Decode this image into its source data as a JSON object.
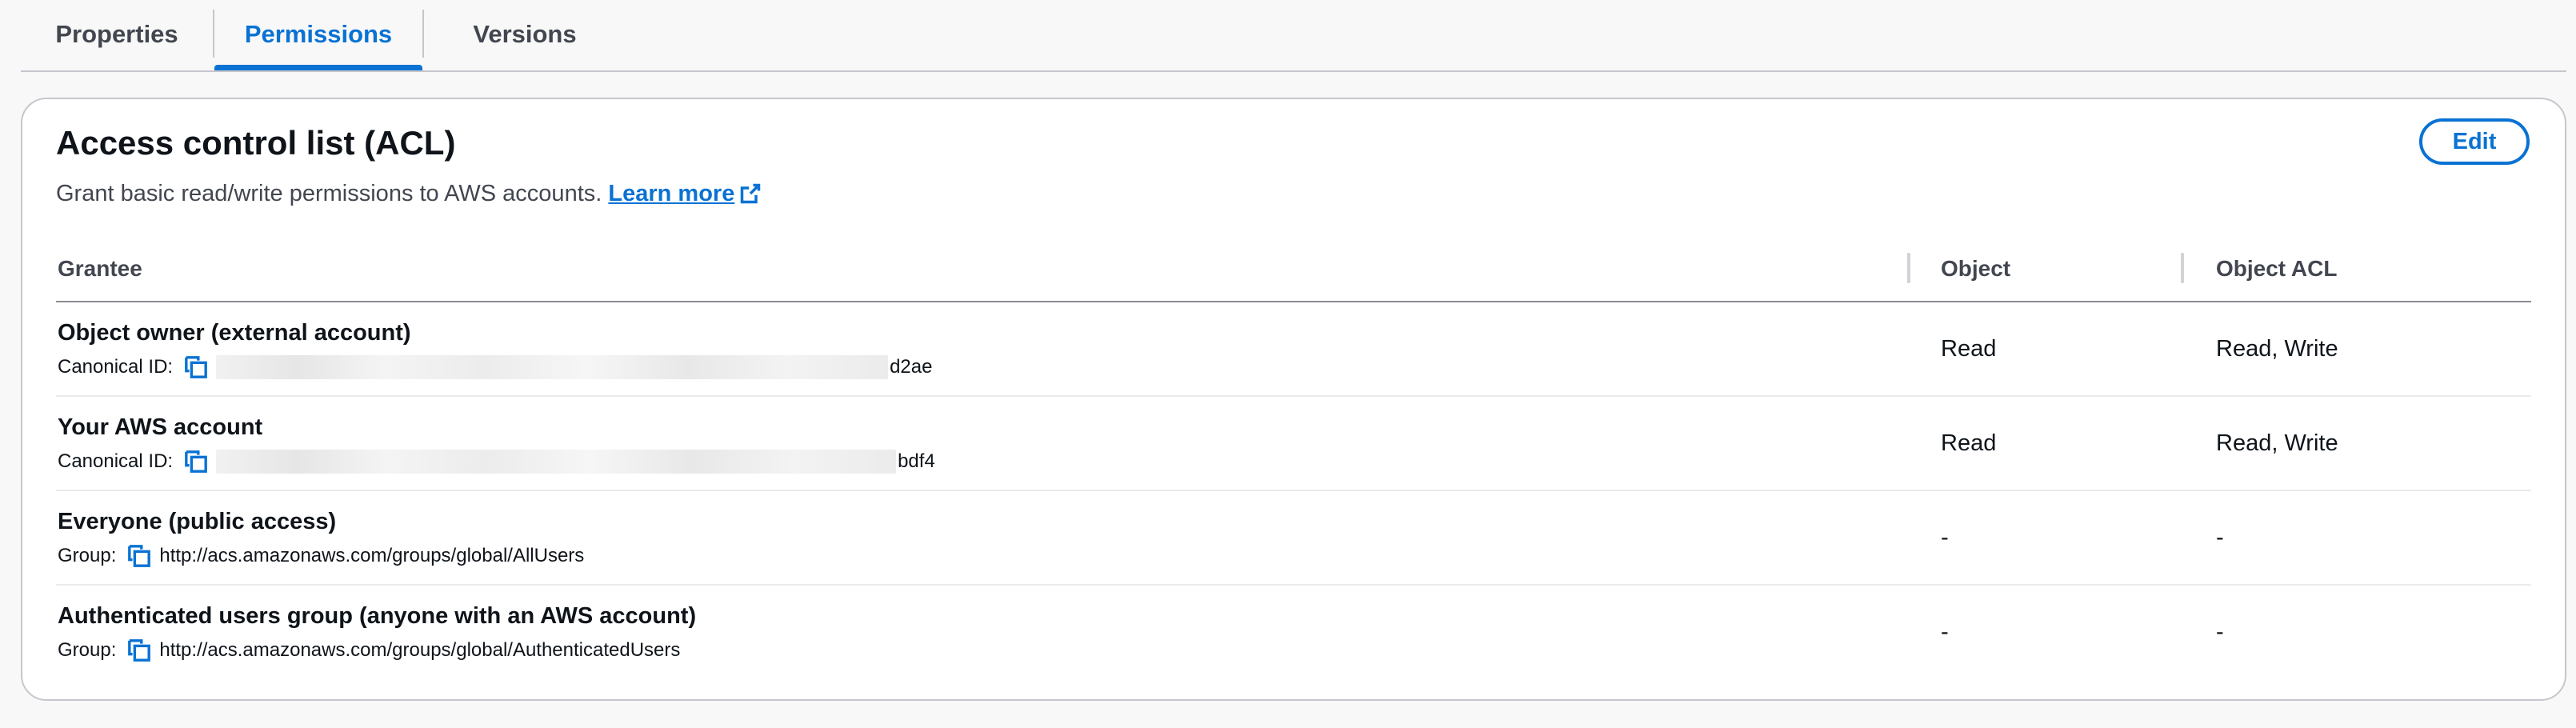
{
  "tabs": [
    {
      "label": "Properties",
      "active": false
    },
    {
      "label": "Permissions",
      "active": true
    },
    {
      "label": "Versions",
      "active": false
    }
  ],
  "panel": {
    "title": "Access control list (ACL)",
    "description": "Grant basic read/write permissions to AWS accounts.",
    "learn_more": "Learn more",
    "edit_label": "Edit"
  },
  "table": {
    "headers": [
      "Grantee",
      "Object",
      "Object ACL"
    ],
    "rows": [
      {
        "name": "Object owner (external account)",
        "sub_label": "Canonical ID:",
        "sub_value": "d2ae",
        "redacted": true,
        "object": "Read",
        "object_acl": "Read, Write"
      },
      {
        "name": "Your AWS account",
        "sub_label": "Canonical ID:",
        "sub_value": "bdf4",
        "redacted": true,
        "object": "Read",
        "object_acl": "Read, Write"
      },
      {
        "name": "Everyone (public access)",
        "sub_label": "Group:",
        "sub_value": "http://acs.amazonaws.com/groups/global/AllUsers",
        "redacted": false,
        "object": "-",
        "object_acl": "-"
      },
      {
        "name": "Authenticated users group (anyone with an AWS account)",
        "sub_label": "Group:",
        "sub_value": "http://acs.amazonaws.com/groups/global/AuthenticatedUsers",
        "redacted": false,
        "object": "-",
        "object_acl": "-"
      }
    ]
  },
  "icons": {
    "copy": "copy-icon",
    "external_link": "external-link-icon"
  },
  "colors": {
    "accent": "#0972d3",
    "text": "#0f141a",
    "muted": "#424650",
    "border": "#c6c6cd"
  }
}
